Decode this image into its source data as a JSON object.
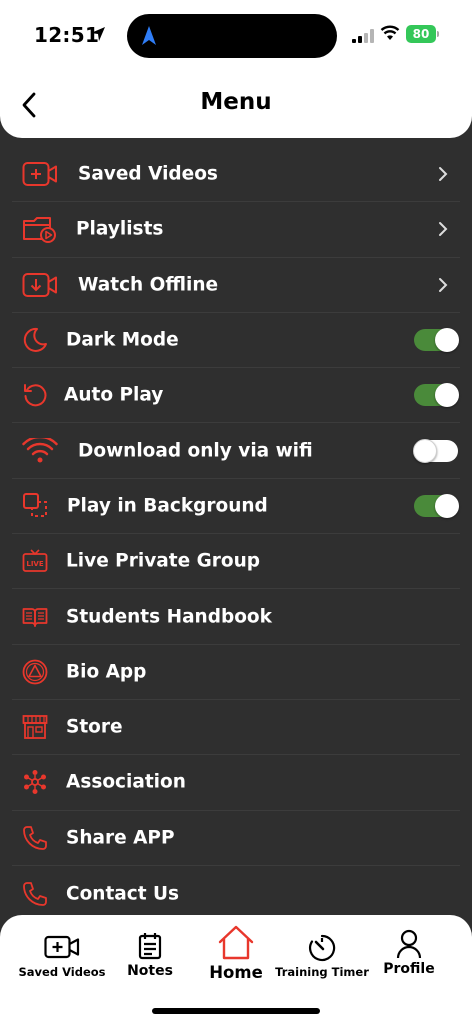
{
  "status_bar": {
    "time": "12:51",
    "battery": "80"
  },
  "header": {
    "title": "Menu"
  },
  "menu": {
    "items": [
      {
        "label": "Saved Videos",
        "icon": "video-plus-icon",
        "control": "chevron"
      },
      {
        "label": "Playlists",
        "icon": "playlist-folder-icon",
        "control": "chevron"
      },
      {
        "label": "Watch Offline",
        "icon": "download-video-icon",
        "control": "chevron"
      },
      {
        "label": "Dark Mode",
        "icon": "moon-icon",
        "control": "toggle",
        "on": true
      },
      {
        "label": "Auto Play",
        "icon": "replay-icon",
        "control": "toggle",
        "on": true
      },
      {
        "label": "Download only via wifi",
        "icon": "wifi-icon",
        "control": "toggle",
        "on": false
      },
      {
        "label": "Play in Background",
        "icon": "picture-in-picture-icon",
        "control": "toggle",
        "on": true
      },
      {
        "label": "Live Private Group",
        "icon": "live-tv-icon",
        "control": "none"
      },
      {
        "label": "Students Handbook",
        "icon": "book-icon",
        "control": "none"
      },
      {
        "label": "Bio App",
        "icon": "bio-app-icon",
        "control": "none"
      },
      {
        "label": "Store",
        "icon": "store-icon",
        "control": "none"
      },
      {
        "label": "Association",
        "icon": "association-icon",
        "control": "none"
      },
      {
        "label": "Share APP",
        "icon": "phone-icon",
        "control": "none"
      },
      {
        "label": "Contact Us",
        "icon": "phone-icon",
        "control": "none"
      }
    ]
  },
  "tabbar": {
    "tabs": [
      {
        "label": "Saved Videos",
        "icon": "video-plus-icon"
      },
      {
        "label": "Notes",
        "icon": "notes-icon"
      },
      {
        "label": "Home",
        "icon": "home-icon",
        "active": true
      },
      {
        "label": "Training Timer",
        "icon": "timer-icon"
      },
      {
        "label": "Profile",
        "icon": "profile-icon"
      }
    ]
  },
  "colors": {
    "accent": "#e8372c",
    "background": "#2f2f2f",
    "toggle_on": "#4a8a3a"
  }
}
